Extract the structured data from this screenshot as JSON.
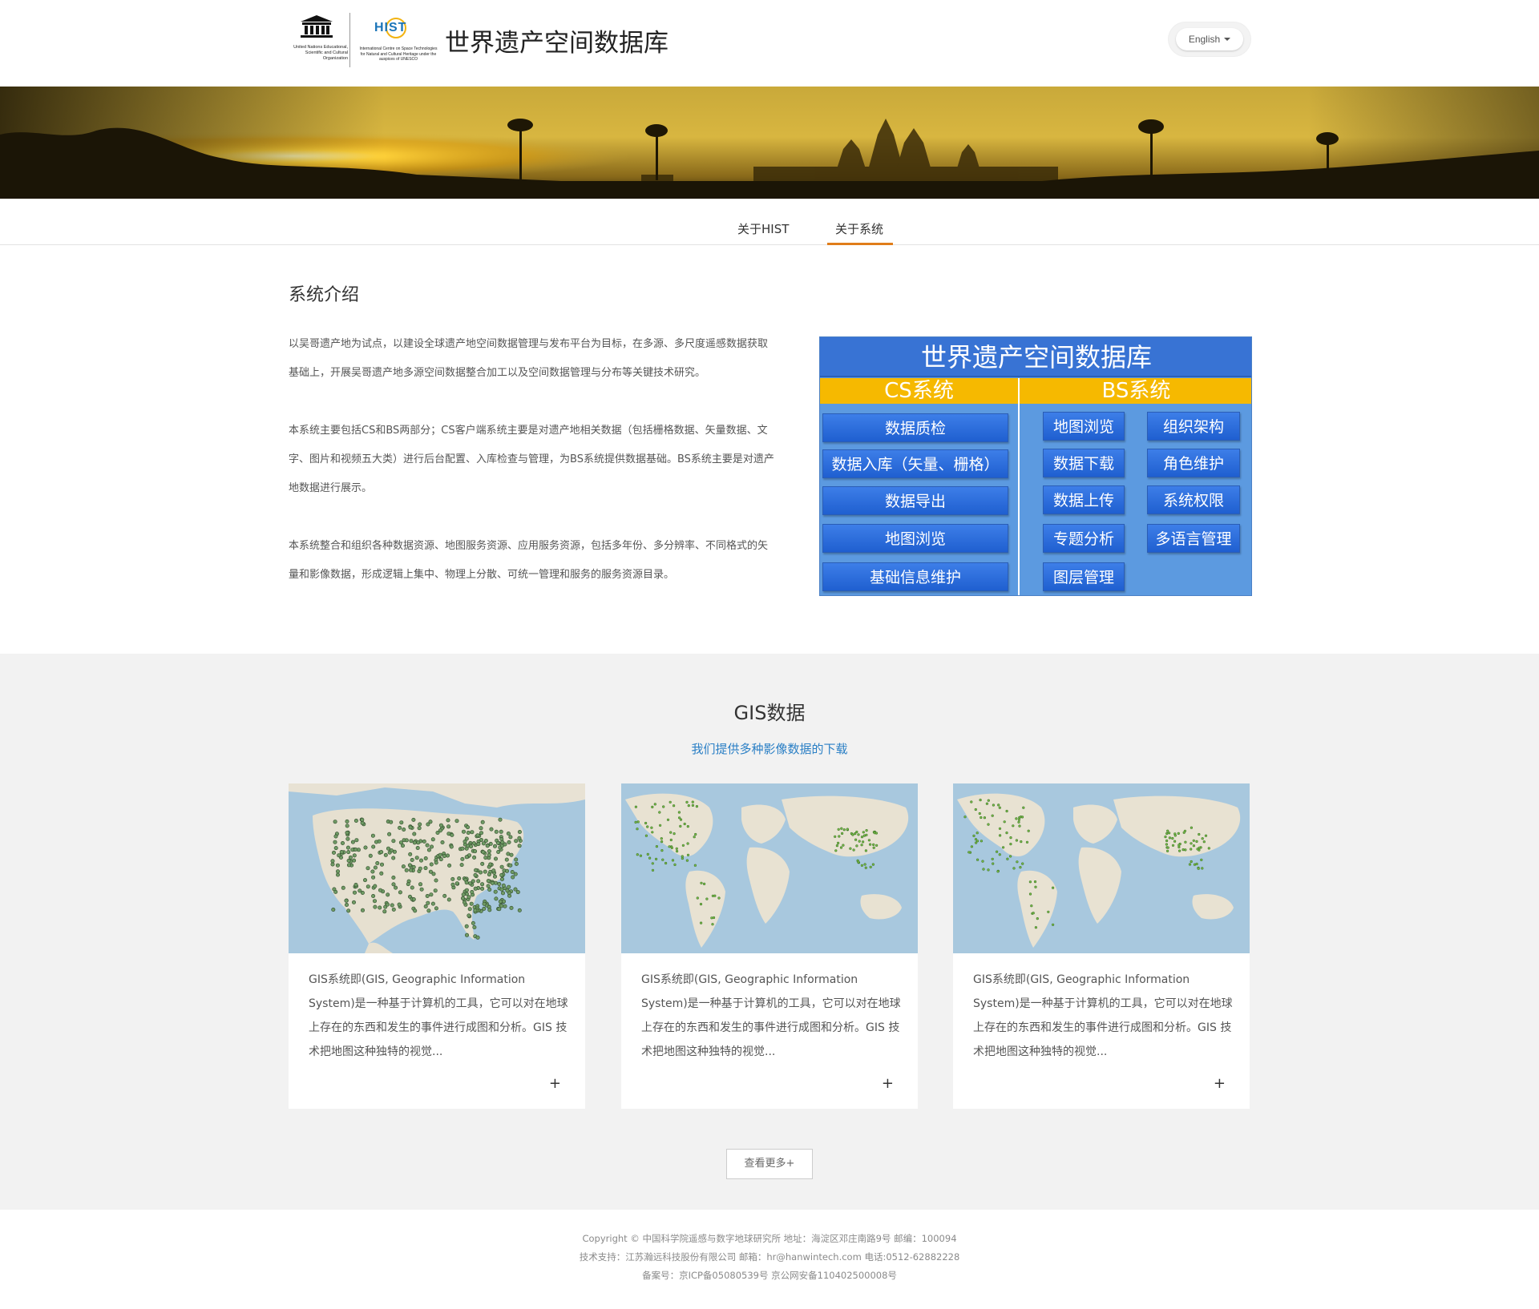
{
  "header": {
    "site_title": "世界遗产空间数据库",
    "unesco_text": "United Nations Educational, Scientific and Cultural Organization",
    "hist_mark": "HIST",
    "hist_text": "International Centre on Space Technologies for Natural and Cultural Heritage under the auspices of UNESCO",
    "language": "English"
  },
  "nav": {
    "items": [
      "关于HIST",
      "关于系统"
    ],
    "active": "关于系统",
    "accent": "#e07d1a"
  },
  "intro": {
    "title": "系统介绍",
    "paragraphs": [
      "以吴哥遗产地为试点，以建设全球遗产地空间数据管理与发布平台为目标，在多源、多尺度遥感数据获取基础上，开展吴哥遗产地多源空间数据整合加工以及空间数据管理与分布等关键技术研究。",
      "本系统主要包括CS和BS两部分；CS客户端系统主要是对遗产地相关数据（包括栅格数据、矢量数据、文字、图片和视频五大类）进行后台配置、入库检查与管理，为BS系统提供数据基础。BS系统主要是对遗产地数据进行展示。",
      "本系统整合和组织各种数据资源、地图服务资源、应用服务资源，包括多年份、多分辨率、不同格式的矢量和影像数据，形成逻辑上集中、物理上分散、可统一管理和服务的服务资源目录。"
    ]
  },
  "diagram": {
    "title": "世界遗产空间数据库",
    "cs_label": "CS系统",
    "bs_label": "BS系统",
    "cs_items": [
      "数据质检",
      "数据入库（矢量、栅格）",
      "数据导出",
      "地图浏览",
      "基础信息维护"
    ],
    "bs_left": [
      "地图浏览",
      "数据下载",
      "数据上传",
      "专题分析",
      "图层管理"
    ],
    "bs_right": [
      "组织架构",
      "角色维护",
      "系统权限",
      "多语言管理"
    ],
    "colors": {
      "title_bg": "#3873d4",
      "band": "#f6b900",
      "panel": "#5c9ae0"
    }
  },
  "gis": {
    "title": "GIS数据",
    "subtitle": "我们提供多种影像数据的下载",
    "cards": [
      {
        "map": "usa-points-map",
        "text": "GIS系统即(GIS, Geographic Information System)是一种基于计算机的工具，它可以对在地球上存在的东西和发生的事件进行成图和分析。GIS 技术把地图这种独特的视觉...",
        "plus": "+"
      },
      {
        "map": "world-points-map",
        "text": "GIS系统即(GIS, Geographic Information System)是一种基于计算机的工具，它可以对在地球上存在的东西和发生的事件进行成图和分析。GIS 技术把地图这种独特的视觉...",
        "plus": "+"
      },
      {
        "map": "world-points-map",
        "text": "GIS系统即(GIS, Geographic Information System)是一种基于计算机的工具，它可以对在地球上存在的东西和发生的事件进行成图和分析。GIS 技术把地图这种独特的视觉...",
        "plus": "+"
      }
    ],
    "more_label": "查看更多+"
  },
  "footer": {
    "line1": "Copyright © 中国科学院遥感与数字地球研究所     地址：海淀区邓庄南路9号    邮编：100094",
    "line2": "技术支持：江苏瀚远科技股份有限公司      邮箱：hr@hanwintech.com      电话:0512-62882228",
    "line3": "备案号：京ICP备05080539号 京公网安备110402500008号"
  }
}
